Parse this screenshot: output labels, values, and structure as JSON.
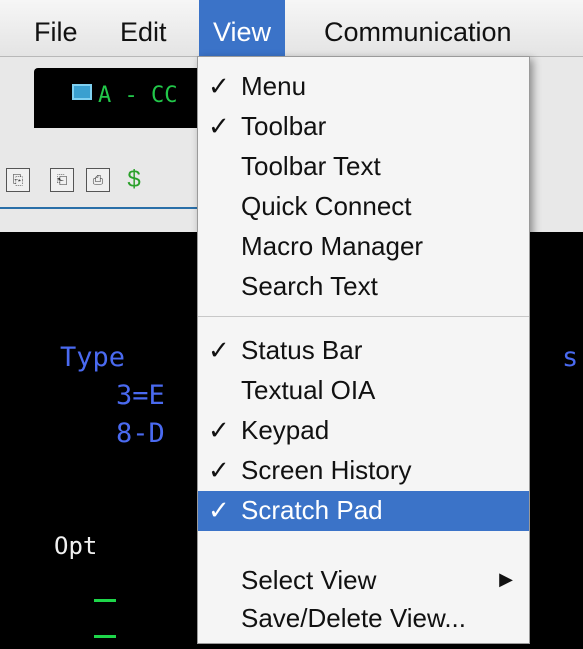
{
  "menubar": {
    "items": [
      {
        "label": "File"
      },
      {
        "label": "Edit"
      },
      {
        "label": "View"
      },
      {
        "label": "Communication"
      }
    ]
  },
  "tab": {
    "label": "A - CC"
  },
  "terminal": {
    "lines": {
      "type": "Type",
      "opt3": "3=E",
      "opt8": "8-D",
      "opt": "Opt",
      "trailing_s": "s"
    }
  },
  "view_menu": {
    "groups": [
      [
        {
          "label": "Menu",
          "checked": true
        },
        {
          "label": "Toolbar",
          "checked": true
        },
        {
          "label": "Toolbar Text",
          "checked": false
        },
        {
          "label": "Quick Connect",
          "checked": false
        },
        {
          "label": "Macro Manager",
          "checked": false
        },
        {
          "label": "Search Text",
          "checked": false
        }
      ],
      [
        {
          "label": "Status Bar",
          "checked": true
        },
        {
          "label": "Textual OIA",
          "checked": false
        },
        {
          "label": "Keypad",
          "checked": true
        },
        {
          "label": "Screen History",
          "checked": true
        },
        {
          "label": "Scratch Pad",
          "checked": true,
          "highlighted": true
        }
      ],
      [
        {
          "label": "Select View",
          "checked": false,
          "submenu": true
        },
        {
          "label": "Save/Delete View...",
          "checked": false
        }
      ]
    ],
    "check_glyph": "✓",
    "submenu_glyph": "▶"
  },
  "colors": {
    "highlight": "#3b73c8",
    "terminal_blue": "#4a6af0",
    "terminal_green": "#1ed64a"
  }
}
